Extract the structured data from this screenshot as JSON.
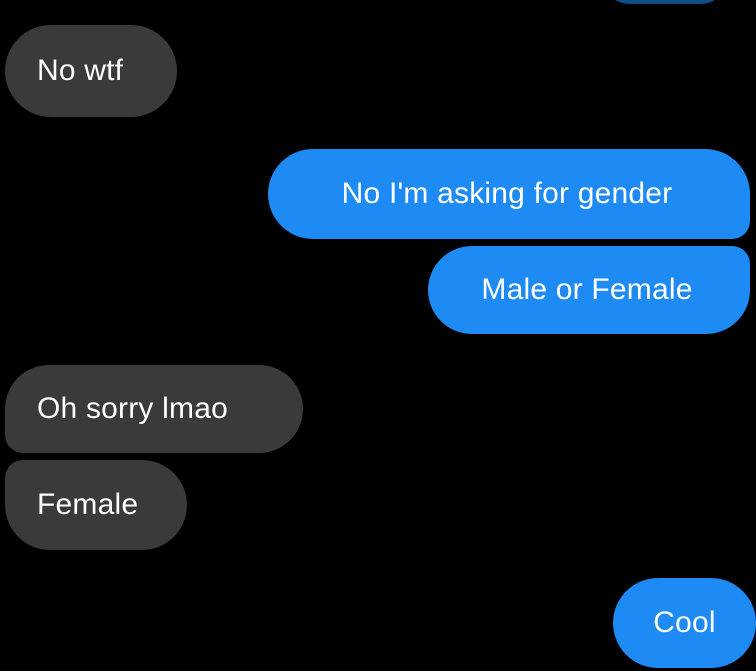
{
  "conversation": {
    "messages": [
      {
        "id": "m1",
        "sender": "other",
        "text": "No wtf"
      },
      {
        "id": "m2",
        "sender": "me",
        "text": "No I'm asking for gender"
      },
      {
        "id": "m3",
        "sender": "me",
        "text": "Male or Female"
      },
      {
        "id": "m4",
        "sender": "other",
        "text": "Oh sorry lmao"
      },
      {
        "id": "m5",
        "sender": "other",
        "text": "Female"
      },
      {
        "id": "m6",
        "sender": "me",
        "text": "Cool"
      }
    ]
  },
  "colors": {
    "background": "#000000",
    "incoming_bubble": "#3a3a3c",
    "outgoing_bubble": "#1d8bf3",
    "text": "#ffffff"
  }
}
